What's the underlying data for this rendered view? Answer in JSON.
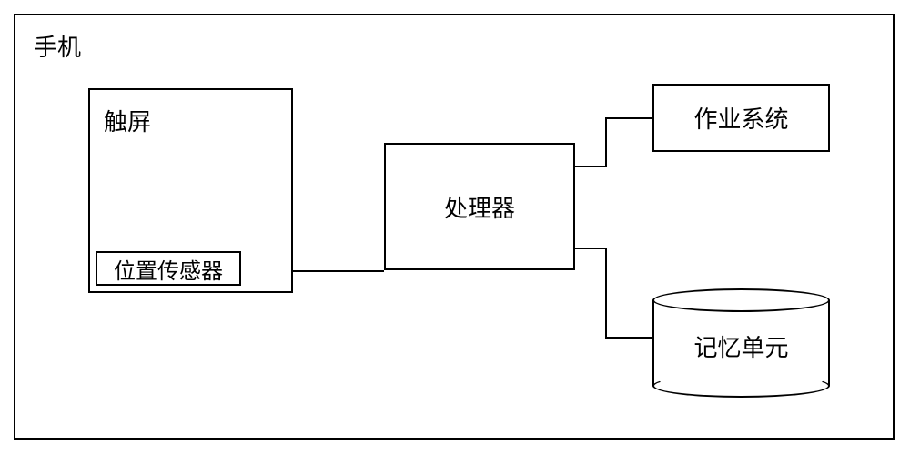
{
  "diagram": {
    "container_label": "手机",
    "components": {
      "touchscreen": {
        "label": "触屏",
        "sub_component": {
          "position_sensor": "位置传感器"
        }
      },
      "processor": "处理器",
      "operating_system": "作业系统",
      "memory_unit": "记忆单元"
    },
    "connections": [
      {
        "from": "触屏",
        "to": "处理器"
      },
      {
        "from": "处理器",
        "to": "作业系统"
      },
      {
        "from": "处理器",
        "to": "记忆单元"
      }
    ]
  },
  "chart_data": {
    "type": "diagram",
    "title": "手机",
    "nodes": [
      {
        "id": "phone",
        "label": "手机",
        "type": "container"
      },
      {
        "id": "touchscreen",
        "label": "触屏",
        "type": "box",
        "parent": "phone"
      },
      {
        "id": "position_sensor",
        "label": "位置传感器",
        "type": "box",
        "parent": "touchscreen"
      },
      {
        "id": "processor",
        "label": "处理器",
        "type": "box",
        "parent": "phone"
      },
      {
        "id": "os",
        "label": "作业系统",
        "type": "box",
        "parent": "phone"
      },
      {
        "id": "memory",
        "label": "记忆单元",
        "type": "cylinder",
        "parent": "phone"
      }
    ],
    "edges": [
      {
        "from": "touchscreen",
        "to": "processor"
      },
      {
        "from": "processor",
        "to": "os"
      },
      {
        "from": "processor",
        "to": "memory"
      }
    ]
  }
}
